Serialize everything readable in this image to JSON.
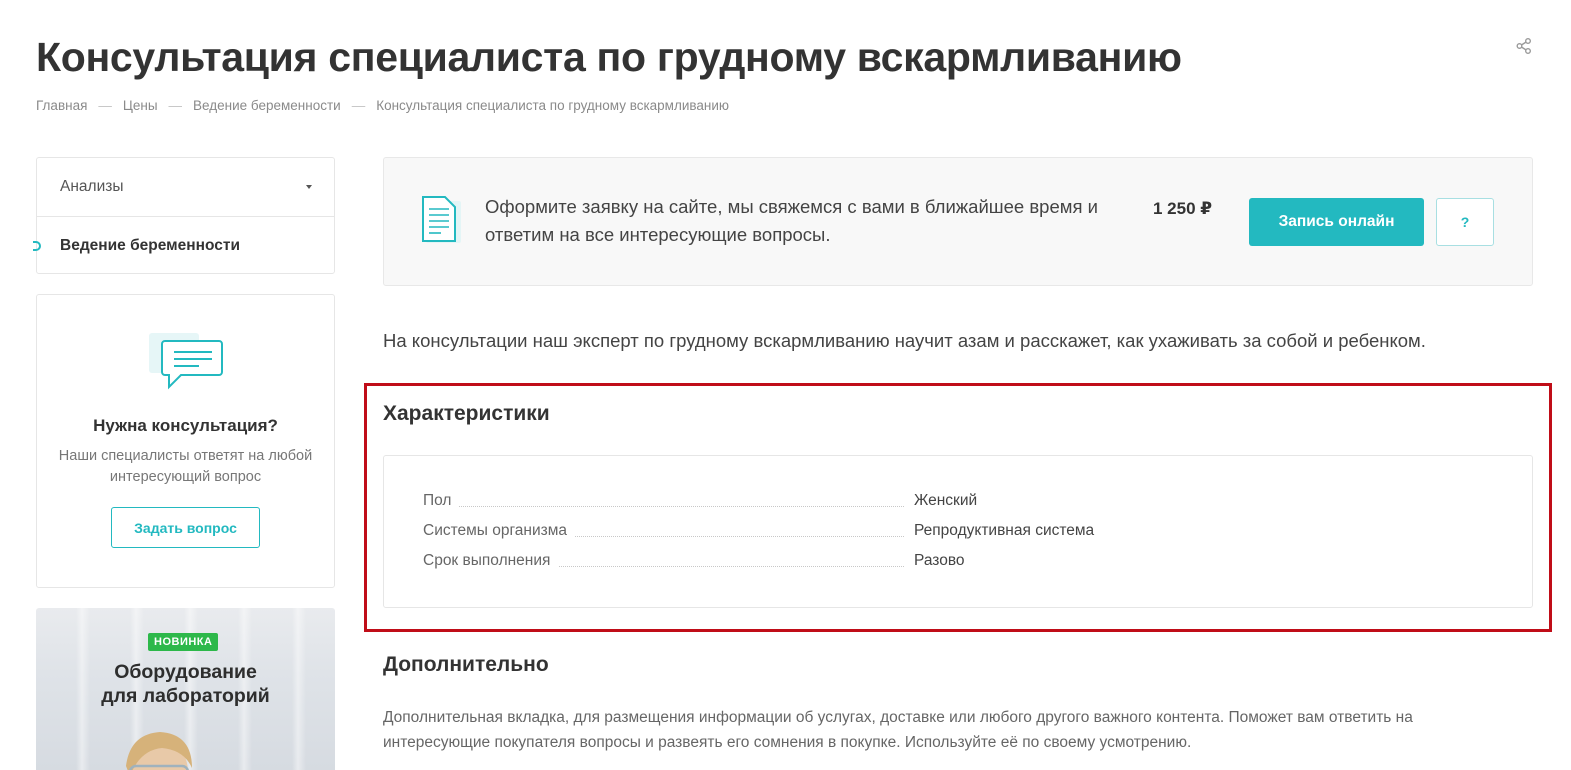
{
  "page": {
    "title": "Консультация специалиста по грудному вскармливанию",
    "share_icon": "share-icon"
  },
  "breadcrumb": [
    "Главная",
    "Цены",
    "Ведение беременности",
    "Консультация специалиста по грудному вскармливанию"
  ],
  "breadcrumb_separator": "—",
  "sidebar": {
    "menu": [
      {
        "label": "Анализы",
        "icon": "caret-down-icon"
      },
      {
        "label": "Ведение беременности",
        "active": true
      }
    ],
    "consult": {
      "icon": "chat-bubble-icon",
      "title": "Нужна консультация?",
      "desc": "Наши специалисты ответят на любой интересующий вопрос",
      "button": "Задать вопрос"
    },
    "promo": {
      "badge": "НОВИНКА",
      "title_line1": "Оборудование",
      "title_line2": "для лабораторий"
    }
  },
  "order": {
    "icon": "document-icon",
    "text": "Оформите заявку на сайте, мы свяжемся с вами в ближайшее время и ответим на все интересующие вопросы.",
    "price": "1 250 ₽",
    "book_button": "Запись онлайн",
    "question_button": "?"
  },
  "intro": "На консультации наш эксперт по грудному вскармливанию научит азам и расскажет, как ухаживать за собой и ребенком.",
  "characteristics": {
    "title": "Характеристики",
    "rows": [
      {
        "name": "Пол",
        "value": "Женский"
      },
      {
        "name": "Системы организма",
        "value": "Репродуктивная система"
      },
      {
        "name": "Срок выполнения",
        "value": "Разово"
      }
    ]
  },
  "extra": {
    "title": "Дополнительно",
    "text": "Дополнительная вкладка, для размещения информации об услугах, доставке или любого другого важного контента. Поможет вам ответить на интересующие покупателя вопросы и развеять его сомнения в покупке. Используйте её по своему усмотрению."
  },
  "colors": {
    "accent": "#23b9c0",
    "badge_green": "#2db84a",
    "highlight_red": "#c00d18"
  }
}
